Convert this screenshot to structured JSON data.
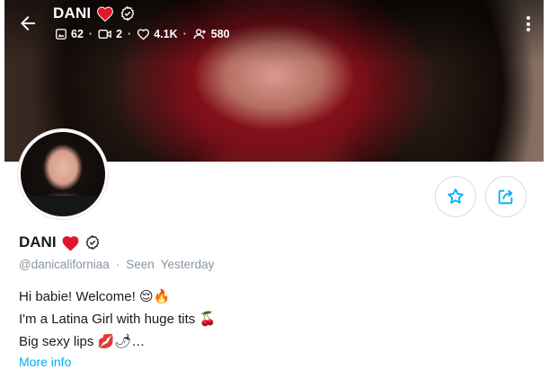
{
  "header": {
    "name": "DANI",
    "stats": {
      "photos": "62",
      "videos": "2",
      "likes": "4.1K",
      "fans": "580"
    }
  },
  "profile": {
    "name": "DANI",
    "handle": "@danicaliforniaa",
    "seen_label": "Seen",
    "seen_value": "Yesterday"
  },
  "bio": {
    "line1": "Hi babie! Welcome!",
    "line1_emojis": "😌🔥",
    "line2": "I'm a Latina Girl with huge tits",
    "line2_emojis": "🍒",
    "line3": "Big sexy lips",
    "line3_emojis": "💋🌶",
    "line3_suffix": "…"
  },
  "more_info": "More info",
  "colors": {
    "accent": "#00aff0",
    "heart": "#e0162b",
    "muted": "#8a96a3"
  },
  "icons": [
    "back-arrow-icon",
    "heart-icon",
    "verified-icon",
    "image-icon",
    "video-icon",
    "like-icon",
    "fans-icon",
    "more-vert-icon",
    "star-icon",
    "share-icon"
  ]
}
